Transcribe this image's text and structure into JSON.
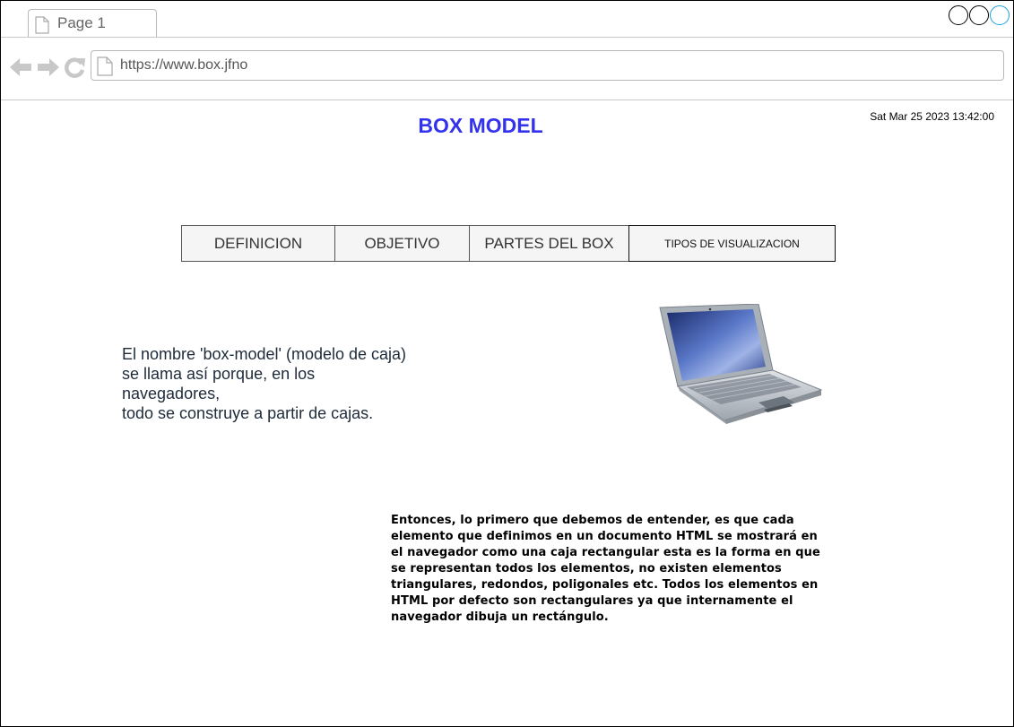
{
  "browser": {
    "tab_label": "Page 1",
    "url": "https://www.box.jfno"
  },
  "page": {
    "title": "BOX MODEL",
    "datetime": "Sat Mar 25 2023 13:42:00",
    "menu": [
      {
        "label": "DEFINICION"
      },
      {
        "label": "OBJETIVO"
      },
      {
        "label": "PARTES DEL BOX"
      },
      {
        "label": "TIPOS DE VISUALIZACION"
      }
    ],
    "intro_lines": [
      "El nombre 'box-model' (modelo de caja)",
      "se llama así porque, en los",
      "navegadores,",
      "todo se construye a partir de cajas."
    ],
    "body_text": "Entonces, lo primero que debemos de entender, es que cada elemento que definimos en un documento HTML se mostrará en el navegador como una caja rectangular esta es la forma en que se representan todos los elementos, no existen elementos triangulares, redondos, poligonales etc. Todos los elementos en HTML por defecto son rectangulares ya que internamente el navegador dibuja un rectángulo.",
    "image_icon": "laptop-image"
  },
  "colors": {
    "title": "#3333ee",
    "window_control_accent": "#1ba1e2"
  }
}
